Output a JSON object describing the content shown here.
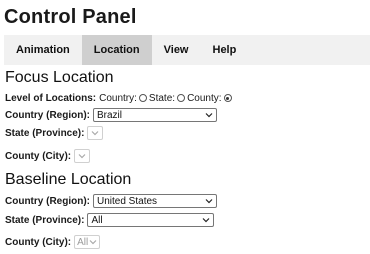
{
  "app": {
    "title": "Control Panel"
  },
  "menu": {
    "tabs": [
      "Animation",
      "Location",
      "View",
      "Help"
    ],
    "active": "Location"
  },
  "focus": {
    "heading": "Focus Location",
    "level_label": "Level of Locations:",
    "level_options": [
      "Country:",
      "State:",
      "County:"
    ],
    "level_selected": "County:",
    "country_label": "Country (Region):",
    "country_value": "Brazil",
    "state_label": "State (Province):",
    "state_value": "",
    "county_label": "County (City):",
    "county_value": ""
  },
  "baseline": {
    "heading": "Baseline Location",
    "country_label": "Country (Region):",
    "country_value": "United States",
    "state_label": "State (Province):",
    "state_value": "All",
    "county_label": "County (City):",
    "county_value": "All"
  },
  "icons": {
    "dropdown": "chevron-down-icon",
    "radio": "radio-button-icon"
  }
}
